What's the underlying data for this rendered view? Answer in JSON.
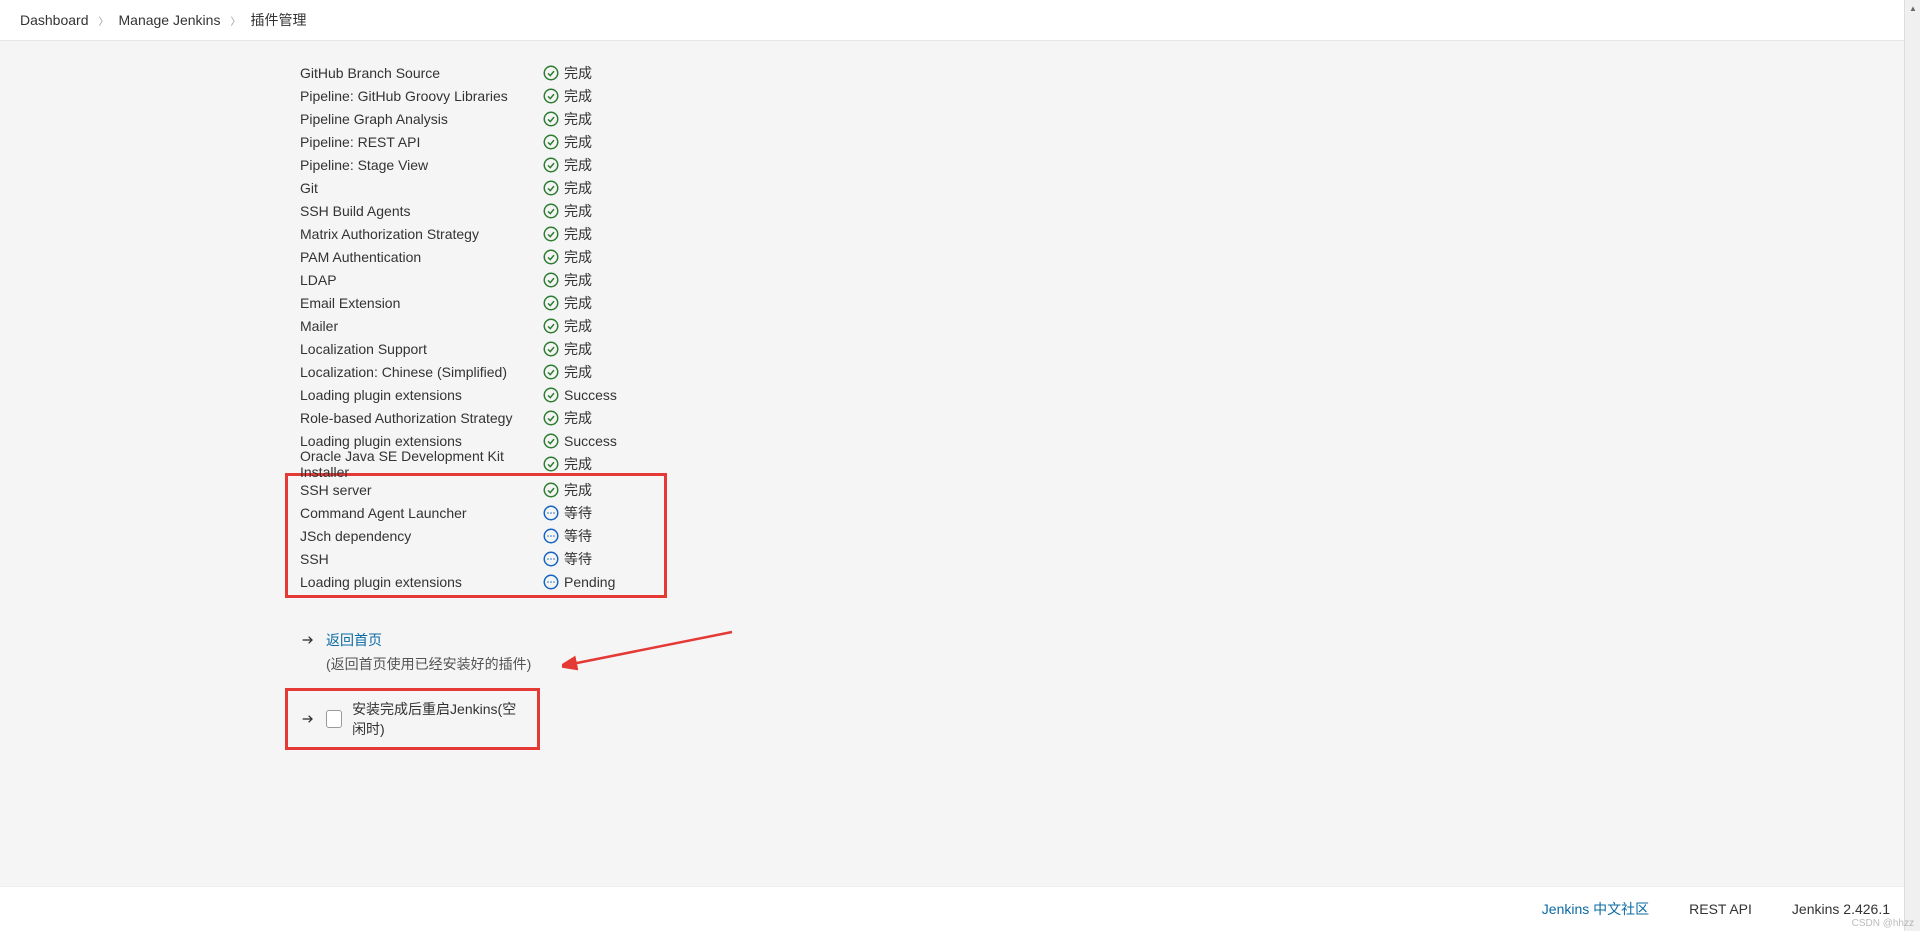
{
  "breadcrumb": {
    "items": [
      {
        "label": "Dashboard"
      },
      {
        "label": "Manage Jenkins"
      },
      {
        "label": "插件管理"
      }
    ]
  },
  "plugins": [
    {
      "name": "GitHub Branch Source",
      "status": "success",
      "status_text": "完成"
    },
    {
      "name": "Pipeline: GitHub Groovy Libraries",
      "status": "success",
      "status_text": "完成"
    },
    {
      "name": "Pipeline Graph Analysis",
      "status": "success",
      "status_text": "完成"
    },
    {
      "name": "Pipeline: REST API",
      "status": "success",
      "status_text": "完成"
    },
    {
      "name": "Pipeline: Stage View",
      "status": "success",
      "status_text": "完成"
    },
    {
      "name": "Git",
      "status": "success",
      "status_text": "完成"
    },
    {
      "name": "SSH Build Agents",
      "status": "success",
      "status_text": "完成"
    },
    {
      "name": "Matrix Authorization Strategy",
      "status": "success",
      "status_text": "完成"
    },
    {
      "name": "PAM Authentication",
      "status": "success",
      "status_text": "完成"
    },
    {
      "name": "LDAP",
      "status": "success",
      "status_text": "完成"
    },
    {
      "name": "Email Extension",
      "status": "success",
      "status_text": "完成"
    },
    {
      "name": "Mailer",
      "status": "success",
      "status_text": "完成"
    },
    {
      "name": "Localization Support",
      "status": "success",
      "status_text": "完成"
    },
    {
      "name": "Localization: Chinese (Simplified)",
      "status": "success",
      "status_text": "完成"
    },
    {
      "name": "Loading plugin extensions",
      "status": "success",
      "status_text": "Success"
    },
    {
      "name": "Role-based Authorization Strategy",
      "status": "success",
      "status_text": "完成"
    },
    {
      "name": "Loading plugin extensions",
      "status": "success",
      "status_text": "Success"
    },
    {
      "name": "Oracle Java SE Development Kit Installer",
      "status": "success",
      "status_text": "完成"
    }
  ],
  "highlighted_plugins": [
    {
      "name": "SSH server",
      "status": "success",
      "status_text": "完成"
    },
    {
      "name": "Command Agent Launcher",
      "status": "pending",
      "status_text": "等待"
    },
    {
      "name": "JSch dependency",
      "status": "pending",
      "status_text": "等待"
    },
    {
      "name": "SSH",
      "status": "pending",
      "status_text": "等待"
    },
    {
      "name": "Loading plugin extensions",
      "status": "pending",
      "status_text": "Pending"
    }
  ],
  "actions": {
    "return_link": "返回首页",
    "return_desc": "(返回首页使用已经安装好的插件)",
    "restart_label": "安装完成后重启Jenkins(空闲时)"
  },
  "footer": {
    "community_link": "Jenkins 中文社区",
    "rest_api": "REST API",
    "version": "Jenkins 2.426.1"
  },
  "watermark": "CSDN @hhzz"
}
